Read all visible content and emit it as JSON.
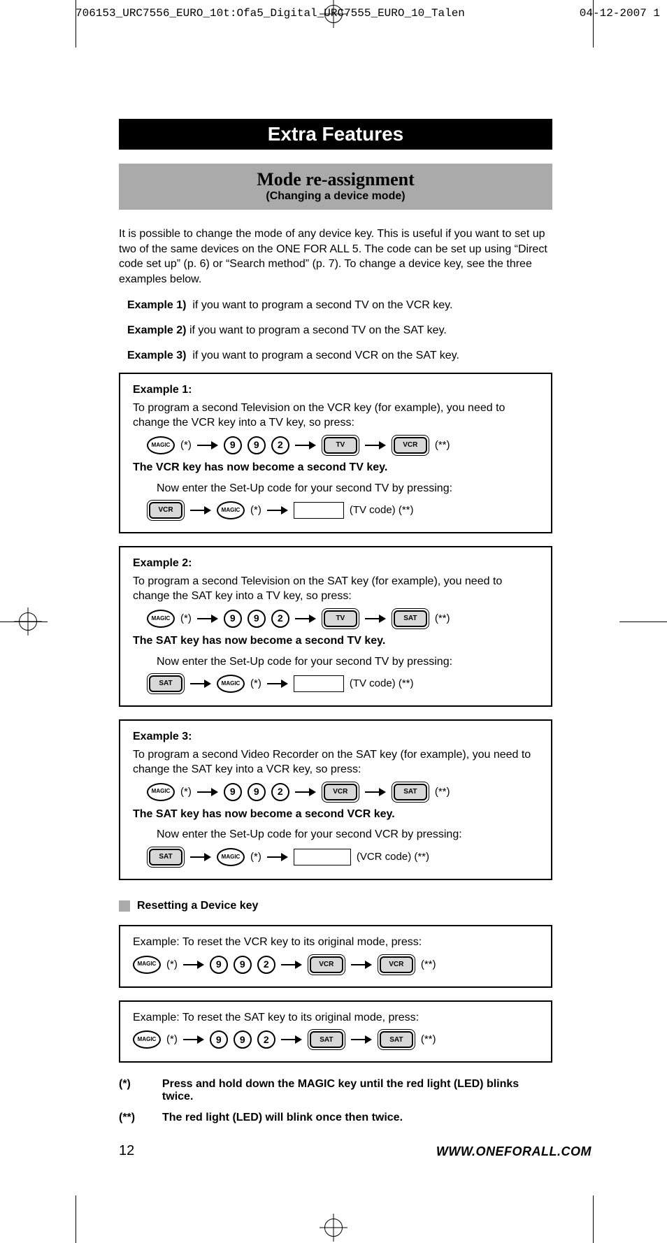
{
  "runner": {
    "left": "706153_URC7556_EURO_10t:Ofa5_Digital_URC7555_EURO_10_Talen",
    "right": "04-12-2007  1"
  },
  "header": {
    "extra_features": "Extra Features",
    "title": "Mode re-assignment",
    "subtitle": "(Changing a device mode)"
  },
  "intro": "It is possible to change the mode of any device key. This is useful if you want to set up two of the same devices on the ONE FOR ALL 5. The code can be set up using “Direct code set up” (p. 6) or “Search method” (p. 7). To change a device key, see the three examples below.",
  "examples_intro": [
    {
      "label": "Example 1)",
      "text": "if you want to program a second TV on the VCR key."
    },
    {
      "label": "Example 2)",
      "text": "if you want to program a second TV on the SAT key."
    },
    {
      "label": "Example 3)",
      "text": "if you want to program a second VCR on the SAT key."
    }
  ],
  "example1": {
    "title": "Example 1:",
    "desc": "To program a second Television on the VCR key (for example), you need to change the VCR key into a TV key, so press:",
    "seq1": {
      "d1": "9",
      "d2": "9",
      "d3": "2",
      "k1": "TV",
      "k2": "VCR"
    },
    "result": "The VCR key has now become a second TV key.",
    "sub": "Now enter the Set-Up code for your second TV by pressing:",
    "seq2": {
      "mode": "VCR",
      "code_label": "(TV code) (**)"
    }
  },
  "example2": {
    "title": "Example 2:",
    "desc": "To program a second Television on the SAT key (for example), you need to change the SAT key into a TV key, so press:",
    "seq1": {
      "d1": "9",
      "d2": "9",
      "d3": "2",
      "k1": "TV",
      "k2": "SAT"
    },
    "result": "The SAT key has now become a second TV key.",
    "sub": "Now enter the Set-Up code for your second TV by pressing:",
    "seq2": {
      "mode": "SAT",
      "code_label": "(TV code) (**)"
    }
  },
  "example3": {
    "title": "Example 3:",
    "desc": "To program a second Video Recorder on the SAT key (for example), you need to change the SAT key into a VCR key, so press:",
    "seq1": {
      "d1": "9",
      "d2": "9",
      "d3": "2",
      "k1": "VCR",
      "k2": "SAT"
    },
    "result": "The SAT key has now become a second VCR key.",
    "sub": "Now enter the Set-Up code for your second VCR by pressing:",
    "seq2": {
      "mode": "SAT",
      "code_label": "(VCR code) (**)"
    }
  },
  "reset": {
    "heading": "Resetting a Device key",
    "vcr": {
      "text": "Example: To reset the VCR key to its original mode, press:",
      "d1": "9",
      "d2": "9",
      "d3": "2",
      "k1": "VCR",
      "k2": "VCR"
    },
    "sat": {
      "text": "Example: To reset the SAT key to its original mode, press:",
      "d1": "9",
      "d2": "9",
      "d3": "2",
      "k1": "SAT",
      "k2": "SAT"
    }
  },
  "footnotes": {
    "a": {
      "key": "(*)",
      "text": "Press and hold down the MAGIC key until the red light (LED) blinks twice."
    },
    "b": {
      "key": "(**)",
      "text": "The red light (LED) will blink once then twice."
    }
  },
  "page_number": "12",
  "website": "WWW.ONEFORALL.COM",
  "ann": {
    "star": "(*)",
    "dstar": "(**)"
  }
}
